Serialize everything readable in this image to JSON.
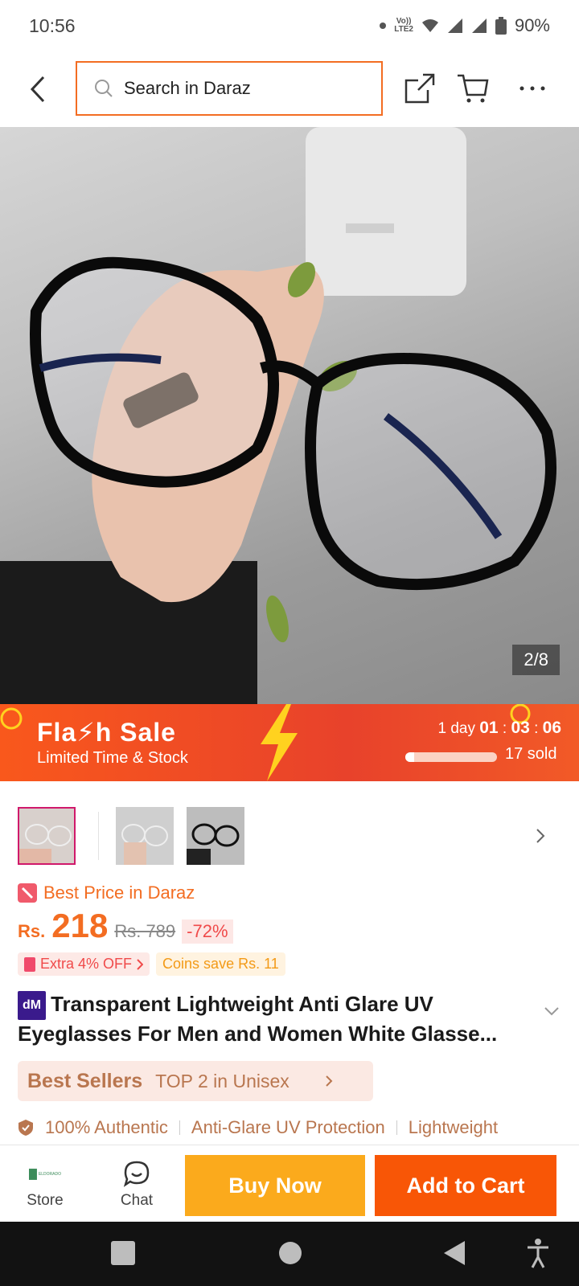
{
  "status_bar": {
    "time": "10:56",
    "network": "LTE2",
    "battery": "90%"
  },
  "header": {
    "search_placeholder": "Search in Daraz"
  },
  "gallery": {
    "counter": "2/8"
  },
  "flash_sale": {
    "title": "Fla⚡h Sale",
    "subtitle": "Limited Time & Stock",
    "countdown_prefix": "1 day",
    "hours": "01",
    "minutes": "03",
    "seconds": "06",
    "sold_progress": 0.1,
    "sold": "17 sold"
  },
  "price": {
    "best_price_label": "Best Price in Daraz",
    "currency": "Rs.",
    "current": "218",
    "original": "Rs. 789",
    "discount": "-72%",
    "extra_offer": "Extra 4% OFF",
    "coins": "Coins save Rs. 11"
  },
  "product": {
    "brand_badge": "dM",
    "title": "Transparent Lightweight Anti Glare UV Eyeglasses For Men and Women White Glasse..."
  },
  "best_sellers": {
    "label": "Best Sellers",
    "rank": "TOP 2 in Unisex"
  },
  "features": [
    "100% Authentic",
    "Anti-Glare UV Protection",
    "Lightweight"
  ],
  "bottom_bar": {
    "store_label": "Store",
    "store_logo_text": "ELDORADO",
    "chat_label": "Chat",
    "buy_now": "Buy Now",
    "add_to_cart": "Add to Cart"
  },
  "colors": {
    "accent": "#f85606",
    "buy_now": "#fbaa1c",
    "search_border": "#f36d22"
  }
}
